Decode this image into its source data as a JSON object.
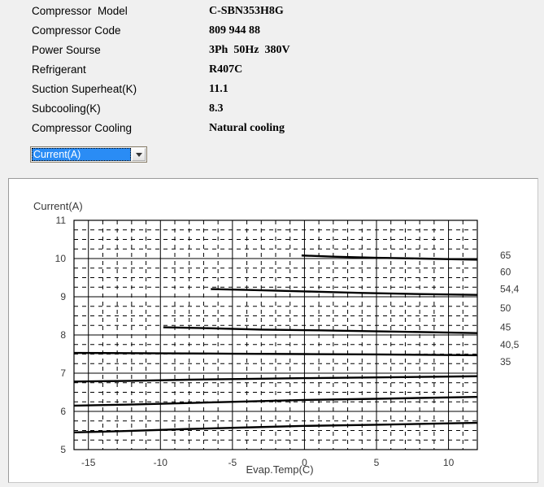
{
  "spec": {
    "rows": [
      {
        "label": "Compressor  Model",
        "value": "C-SBN353H8G"
      },
      {
        "label": "Compressor Code",
        "value": "809 944 88"
      },
      {
        "label": "Power Sourse",
        "value": "3Ph  50Hz  380V"
      },
      {
        "label": "Refrigerant",
        "value": "R407C"
      },
      {
        "label": "Suction Superheat(K)",
        "value": "11.1"
      },
      {
        "label": "Subcooling(K)",
        "value": "8.3"
      },
      {
        "label": "Compressor Cooling",
        "value": "Natural cooling"
      }
    ]
  },
  "series_select": {
    "selected": "Current(A)",
    "options": [
      "Current(A)"
    ],
    "highlight_color": "#2a8cf5"
  },
  "chart_data": {
    "type": "line",
    "title": "",
    "ylabel": "Current(A)",
    "xlabel": "Evap.Temp(C)",
    "xlim": [
      -16,
      12
    ],
    "ylim": [
      5,
      11
    ],
    "xticks": [
      -15,
      -10,
      -5,
      0,
      5,
      10
    ],
    "yticks": [
      11,
      10,
      9,
      8,
      7,
      6,
      5
    ],
    "grid": true,
    "grid_minor_x_step": 1,
    "grid_minor_y_step": 0.25,
    "legend_position": "right-axis-labels",
    "right_axis_label_title": "",
    "series": [
      {
        "name": "65",
        "label": "65",
        "label_y": 10.08,
        "x": [
          -0.2,
          2.0,
          5.0,
          8.0,
          12.0
        ],
        "values": [
          10.08,
          10.05,
          10.02,
          10.0,
          9.97
        ]
      },
      {
        "name": "60",
        "label": "60",
        "label_y": 9.65,
        "x": [],
        "values": []
      },
      {
        "name": "54,4",
        "label": "54,4",
        "label_y": 9.2,
        "x": [
          -6.5,
          -4.0,
          0.0,
          4.0,
          8.0,
          12.0
        ],
        "values": [
          9.2,
          9.18,
          9.14,
          9.1,
          9.07,
          9.05
        ]
      },
      {
        "name": "50",
        "label": "50",
        "label_y": 8.7,
        "x": [],
        "values": []
      },
      {
        "name": "45",
        "label": "45",
        "label_y": 8.2,
        "x": [
          -9.8,
          -7.0,
          -3.0,
          1.0,
          6.0,
          12.0
        ],
        "values": [
          8.2,
          8.18,
          8.14,
          8.12,
          8.09,
          8.05
        ]
      },
      {
        "name": "40,5",
        "label": "40,5",
        "label_y": 7.75,
        "x": [
          -16,
          -10,
          -5,
          0,
          5,
          12
        ],
        "values": [
          7.53,
          7.52,
          7.51,
          7.5,
          7.49,
          7.47
        ]
      },
      {
        "name": "35",
        "label": "35",
        "label_y": 7.3,
        "x": [
          -16,
          -12,
          -8,
          -4,
          0,
          5,
          12
        ],
        "values": [
          6.78,
          6.8,
          6.83,
          6.85,
          6.87,
          6.89,
          6.92
        ]
      },
      {
        "name": "lower-1",
        "label": "",
        "label_y": null,
        "x": [
          -16,
          -12,
          -8,
          -4,
          0,
          5,
          12
        ],
        "values": [
          6.15,
          6.18,
          6.22,
          6.26,
          6.3,
          6.33,
          6.38
        ]
      },
      {
        "name": "lower-2",
        "label": "",
        "label_y": null,
        "x": [
          -16,
          -12,
          -8,
          -4,
          0,
          5,
          12
        ],
        "values": [
          5.45,
          5.49,
          5.54,
          5.58,
          5.62,
          5.65,
          5.7
        ]
      }
    ],
    "right_labels": [
      "65",
      "60",
      "54,4",
      "50",
      "45",
      "40,5",
      "35"
    ]
  }
}
